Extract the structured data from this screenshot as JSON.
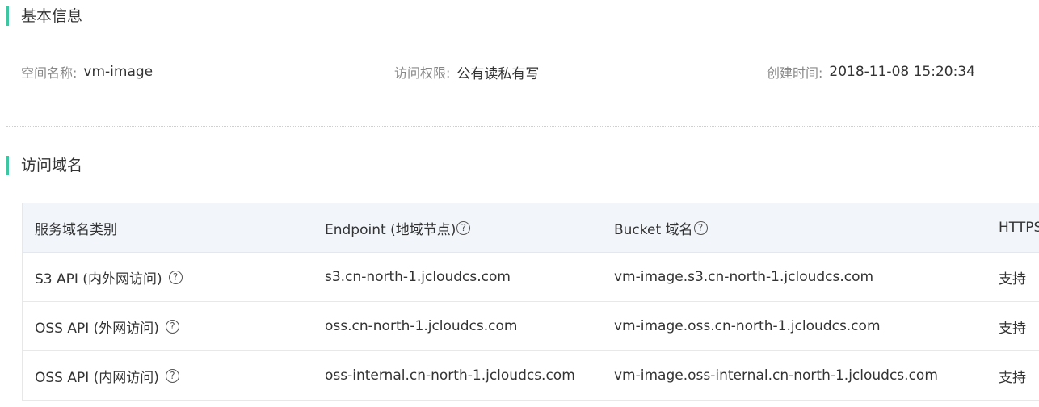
{
  "basic_info": {
    "section_title": "基本信息",
    "space_name_label": "空间名称:",
    "space_name_value": "vm-image",
    "access_label": "访问权限:",
    "access_value": "公有读私有写",
    "created_label": "创建时间:",
    "created_value": "2018-11-08 15:20:34"
  },
  "domains": {
    "section_title": "访问域名",
    "columns": [
      "服务域名类别",
      "Endpoint (地域节点)",
      "Bucket 域名",
      "HTTPS"
    ],
    "rows": [
      {
        "type": "S3 API (内外网访问)",
        "endpoint": "s3.cn-north-1.jcloudcs.com",
        "bucket": "vm-image.s3.cn-north-1.jcloudcs.com",
        "https": "支持"
      },
      {
        "type": "OSS API (外网访问)",
        "endpoint": "oss.cn-north-1.jcloudcs.com",
        "bucket": "vm-image.oss.cn-north-1.jcloudcs.com",
        "https": "支持"
      },
      {
        "type": "OSS API (内网访问)",
        "endpoint": "oss-internal.cn-north-1.jcloudcs.com",
        "bucket": "vm-image.oss-internal.cn-north-1.jcloudcs.com",
        "https": "支持"
      }
    ]
  },
  "icons": {
    "help": "question-circle-icon",
    "help_glyph": "?"
  },
  "colors": {
    "accent": "#3ec6a3",
    "table_header_bg": "#f2f6fb",
    "label": "#888888",
    "text": "#333333"
  }
}
